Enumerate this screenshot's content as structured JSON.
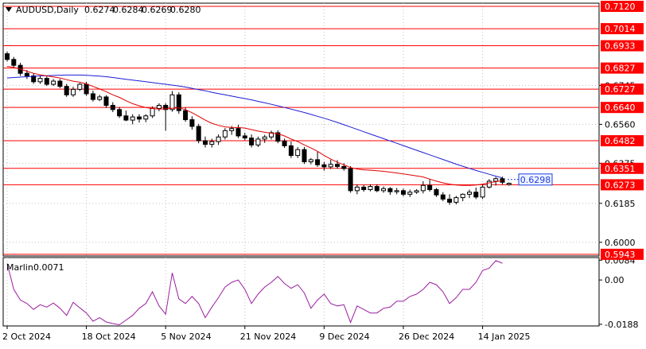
{
  "header": {
    "symbol_timeframe": "AUDUSD,Daily",
    "ohlc": [
      "0.6274",
      "0.6284",
      "0.6269",
      "0.6280"
    ]
  },
  "indicator": {
    "name": "Marlin",
    "value": "0.0071",
    "axis_labels": [
      "0.0084",
      "0.00",
      "-0.0188"
    ]
  },
  "colors": {
    "candle": "#000000",
    "level_line": "#ff0000",
    "ma_fast": "#e00000",
    "ma_slow": "#1c1cd4",
    "oscillator": "#9b1ea0",
    "current_price_box": "#1c3fe0",
    "grid": "#c0c0c0"
  },
  "chart_data": {
    "type": "candlestick",
    "y_range": [
      0.5935,
      0.7135
    ],
    "osc_range": [
      -0.0195,
      0.0095
    ],
    "current_price": "0.6298",
    "levels": [
      "0.7120",
      "0.7014",
      "0.6933",
      "0.6827",
      "0.6727",
      "0.6640",
      "0.6482",
      "0.6351",
      "0.6273",
      "0.5943"
    ],
    "price_ticks": [
      "0.6745",
      "0.6560",
      "0.6375",
      "0.6185",
      "0.6000"
    ],
    "x_ticks": [
      {
        "index": 0,
        "label": "2 Oct 2024"
      },
      {
        "index": 12,
        "label": "18 Oct 2024"
      },
      {
        "index": 24,
        "label": "5 Nov 2024"
      },
      {
        "index": 36,
        "label": "21 Nov 2024"
      },
      {
        "index": 48,
        "label": "9 Dec 2024"
      },
      {
        "index": 60,
        "label": "26 Dec 2024"
      },
      {
        "index": 72,
        "label": "14 Jan 2025"
      }
    ],
    "candles": [
      [
        0.6895,
        0.6905,
        0.6858,
        0.6868
      ],
      [
        0.6868,
        0.688,
        0.6828,
        0.684
      ],
      [
        0.684,
        0.6852,
        0.679,
        0.6802
      ],
      [
        0.6802,
        0.6818,
        0.6775,
        0.679
      ],
      [
        0.679,
        0.6802,
        0.6752,
        0.6762
      ],
      [
        0.6762,
        0.679,
        0.6752,
        0.6778
      ],
      [
        0.6778,
        0.679,
        0.6742,
        0.675
      ],
      [
        0.675,
        0.6775,
        0.6742,
        0.6765
      ],
      [
        0.6765,
        0.6775,
        0.6732,
        0.674
      ],
      [
        0.674,
        0.6752,
        0.669,
        0.67
      ],
      [
        0.67,
        0.6738,
        0.669,
        0.6726
      ],
      [
        0.6726,
        0.6756,
        0.6718,
        0.675
      ],
      [
        0.675,
        0.6762,
        0.6695,
        0.6705
      ],
      [
        0.6705,
        0.672,
        0.6668,
        0.6678
      ],
      [
        0.6678,
        0.67,
        0.667,
        0.669
      ],
      [
        0.669,
        0.6698,
        0.6638,
        0.665
      ],
      [
        0.665,
        0.6665,
        0.6618,
        0.663
      ],
      [
        0.663,
        0.6642,
        0.659,
        0.66
      ],
      [
        0.66,
        0.6625,
        0.6575,
        0.658
      ],
      [
        0.658,
        0.6608,
        0.656,
        0.6595
      ],
      [
        0.6595,
        0.6608,
        0.6568,
        0.6585
      ],
      [
        0.6585,
        0.6608,
        0.657,
        0.66
      ],
      [
        0.66,
        0.6645,
        0.659,
        0.6635
      ],
      [
        0.6635,
        0.666,
        0.6622,
        0.665
      ],
      [
        0.665,
        0.666,
        0.653,
        0.663
      ],
      [
        0.663,
        0.6718,
        0.662,
        0.67
      ],
      [
        0.67,
        0.6712,
        0.661,
        0.6625
      ],
      [
        0.6625,
        0.664,
        0.6572,
        0.6582
      ],
      [
        0.6582,
        0.6598,
        0.6535,
        0.655
      ],
      [
        0.655,
        0.6562,
        0.647,
        0.6482
      ],
      [
        0.6482,
        0.6502,
        0.645,
        0.6465
      ],
      [
        0.6465,
        0.6492,
        0.645,
        0.6478
      ],
      [
        0.6478,
        0.6512,
        0.6462,
        0.65
      ],
      [
        0.65,
        0.6542,
        0.6488,
        0.653
      ],
      [
        0.653,
        0.6552,
        0.651,
        0.654
      ],
      [
        0.654,
        0.6558,
        0.6495,
        0.6505
      ],
      [
        0.6505,
        0.652,
        0.6485,
        0.6495
      ],
      [
        0.6495,
        0.6512,
        0.645,
        0.6462
      ],
      [
        0.6462,
        0.6502,
        0.6452,
        0.649
      ],
      [
        0.649,
        0.651,
        0.6472,
        0.65
      ],
      [
        0.65,
        0.653,
        0.6488,
        0.652
      ],
      [
        0.652,
        0.6532,
        0.647,
        0.648
      ],
      [
        0.648,
        0.6492,
        0.6448,
        0.6458
      ],
      [
        0.6458,
        0.6478,
        0.64,
        0.6412
      ],
      [
        0.6412,
        0.6452,
        0.64,
        0.644
      ],
      [
        0.644,
        0.6452,
        0.6372,
        0.6382
      ],
      [
        0.6382,
        0.64,
        0.637,
        0.6392
      ],
      [
        0.6392,
        0.643,
        0.6358,
        0.6368
      ],
      [
        0.6368,
        0.6382,
        0.634,
        0.6358
      ],
      [
        0.6358,
        0.6392,
        0.6348,
        0.637
      ],
      [
        0.637,
        0.639,
        0.635,
        0.636
      ],
      [
        0.636,
        0.6375,
        0.634,
        0.635
      ],
      [
        0.635,
        0.6362,
        0.6235,
        0.6245
      ],
      [
        0.6245,
        0.6275,
        0.6228,
        0.6262
      ],
      [
        0.6262,
        0.6272,
        0.624,
        0.625
      ],
      [
        0.625,
        0.6275,
        0.6242,
        0.6265
      ],
      [
        0.6265,
        0.6275,
        0.6238,
        0.6245
      ],
      [
        0.6245,
        0.6265,
        0.6235,
        0.6255
      ],
      [
        0.6255,
        0.6262,
        0.6225,
        0.624
      ],
      [
        0.624,
        0.6258,
        0.6228,
        0.6245
      ],
      [
        0.6245,
        0.6255,
        0.6218,
        0.6228
      ],
      [
        0.6228,
        0.625,
        0.6215,
        0.6238
      ],
      [
        0.6238,
        0.6252,
        0.623,
        0.6245
      ],
      [
        0.6245,
        0.629,
        0.6232,
        0.627
      ],
      [
        0.627,
        0.63,
        0.624,
        0.625
      ],
      [
        0.625,
        0.6258,
        0.6215,
        0.6225
      ],
      [
        0.6225,
        0.6238,
        0.6195,
        0.6205
      ],
      [
        0.6205,
        0.6228,
        0.6178,
        0.619
      ],
      [
        0.619,
        0.622,
        0.618,
        0.6212
      ],
      [
        0.6212,
        0.6232,
        0.6195,
        0.6228
      ],
      [
        0.6228,
        0.625,
        0.621,
        0.6238
      ],
      [
        0.6238,
        0.626,
        0.6205,
        0.6215
      ],
      [
        0.6215,
        0.6275,
        0.6205,
        0.6262
      ],
      [
        0.6262,
        0.63,
        0.6255,
        0.629
      ],
      [
        0.629,
        0.631,
        0.627,
        0.6302
      ],
      [
        0.6302,
        0.6312,
        0.6275,
        0.6285
      ],
      [
        0.6274,
        0.6284,
        0.6269,
        0.628
      ]
    ],
    "ma_fast": [
      0.6835,
      0.683,
      0.6822,
      0.6812,
      0.6802,
      0.6795,
      0.679,
      0.6785,
      0.678,
      0.6772,
      0.6765,
      0.676,
      0.6752,
      0.674,
      0.6728,
      0.6715,
      0.67,
      0.6688,
      0.6672,
      0.6658,
      0.6648,
      0.664,
      0.6635,
      0.6632,
      0.6633,
      0.6636,
      0.6638,
      0.663,
      0.6615,
      0.6598,
      0.658,
      0.6565,
      0.6555,
      0.6548,
      0.6545,
      0.6545,
      0.6542,
      0.6535,
      0.6528,
      0.6522,
      0.6518,
      0.6515,
      0.6505,
      0.649,
      0.6478,
      0.6462,
      0.6448,
      0.6432,
      0.6412,
      0.6395,
      0.638,
      0.6368,
      0.6355,
      0.6348,
      0.6344,
      0.6342,
      0.634,
      0.6337,
      0.6333,
      0.6329,
      0.6325,
      0.632,
      0.6315,
      0.631,
      0.63,
      0.629,
      0.6282,
      0.6276,
      0.6272,
      0.627,
      0.627,
      0.6272,
      0.6276,
      0.6282,
      0.6288,
      0.6292
    ],
    "ma_slow": [
      0.678,
      0.6782,
      0.6784,
      0.6786,
      0.6788,
      0.679,
      0.6791,
      0.6792,
      0.6793,
      0.6794,
      0.6794,
      0.6794,
      0.6793,
      0.6791,
      0.6789,
      0.6786,
      0.6782,
      0.6778,
      0.6774,
      0.677,
      0.6766,
      0.6762,
      0.6758,
      0.6754,
      0.675,
      0.6746,
      0.6742,
      0.6737,
      0.6731,
      0.6725,
      0.6719,
      0.6712,
      0.6706,
      0.67,
      0.6694,
      0.6688,
      0.6682,
      0.6676,
      0.6669,
      0.6662,
      0.6655,
      0.6648,
      0.664,
      0.6632,
      0.6624,
      0.6616,
      0.6607,
      0.6598,
      0.6589,
      0.6579,
      0.6569,
      0.6558,
      0.6547,
      0.6536,
      0.6525,
      0.6514,
      0.6503,
      0.6492,
      0.6481,
      0.647,
      0.6459,
      0.6448,
      0.6437,
      0.6426,
      0.6415,
      0.6404,
      0.6393,
      0.6382,
      0.6371,
      0.6361,
      0.6351,
      0.6341,
      0.6332,
      0.6323,
      0.6314,
      0.6306
    ],
    "oscillator": [
      0.007,
      -0.004,
      -0.0085,
      -0.01,
      -0.0125,
      -0.0105,
      -0.0115,
      -0.0098,
      -0.012,
      -0.015,
      -0.0095,
      -0.0118,
      -0.014,
      -0.0175,
      -0.016,
      -0.0178,
      -0.0185,
      -0.019,
      -0.017,
      -0.015,
      -0.012,
      -0.01,
      -0.005,
      -0.011,
      -0.0145,
      0.003,
      -0.008,
      -0.01,
      -0.007,
      -0.01,
      -0.016,
      -0.0115,
      -0.0075,
      -0.003,
      -0.001,
      0.0,
      -0.004,
      -0.01,
      -0.006,
      -0.003,
      -0.001,
      0.0015,
      -0.0015,
      -0.0035,
      -0.002,
      -0.0055,
      -0.012,
      -0.0085,
      -0.006,
      -0.01,
      -0.011,
      -0.0105,
      -0.018,
      -0.011,
      -0.0125,
      -0.014,
      -0.014,
      -0.012,
      -0.0115,
      -0.009,
      -0.009,
      -0.007,
      -0.006,
      -0.004,
      -0.001,
      -0.002,
      -0.005,
      -0.01,
      -0.0075,
      -0.004,
      -0.004,
      -0.001,
      0.004,
      0.005,
      0.0082,
      0.0071
    ]
  }
}
